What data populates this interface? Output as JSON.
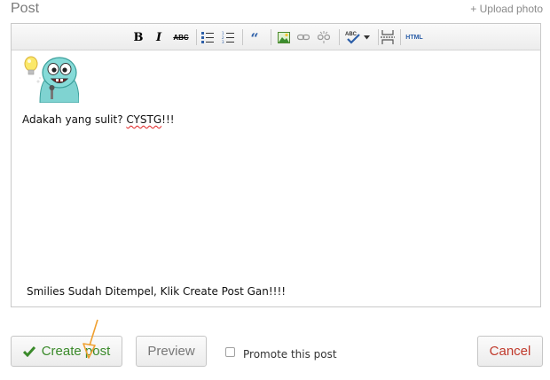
{
  "header": {
    "title": "Post",
    "upload_photo": "+ Upload photo"
  },
  "toolbar": {
    "bold_label": "B",
    "italic_label": "I",
    "strike_label": "ABC",
    "quote_label": "“",
    "html_label": "HTML",
    "icons": [
      "bold-icon",
      "italic-icon",
      "strikethrough-icon",
      "bullet-list-icon",
      "numbered-list-icon",
      "blockquote-icon",
      "insert-image-icon",
      "link-icon",
      "unlink-icon",
      "spellcheck-icon",
      "dropdown-arrow-icon",
      "page-break-icon",
      "html-icon"
    ]
  },
  "content": {
    "text_before": "Adakah yang sulit? ",
    "text_misspelled": "CYSTG",
    "text_after": "!!!",
    "note": "Smilies Sudah Ditempel, Klik Create Post Gan!!!!"
  },
  "actions": {
    "create_label": "Create post",
    "preview_label": "Preview",
    "promote_label": "Promote this post",
    "promote_checked": false,
    "cancel_label": "Cancel"
  },
  "colors": {
    "create_text": "#3a8a2a",
    "cancel_text": "#c0392b",
    "spell_underline": "#e02020",
    "arrow": "#f0a030"
  }
}
